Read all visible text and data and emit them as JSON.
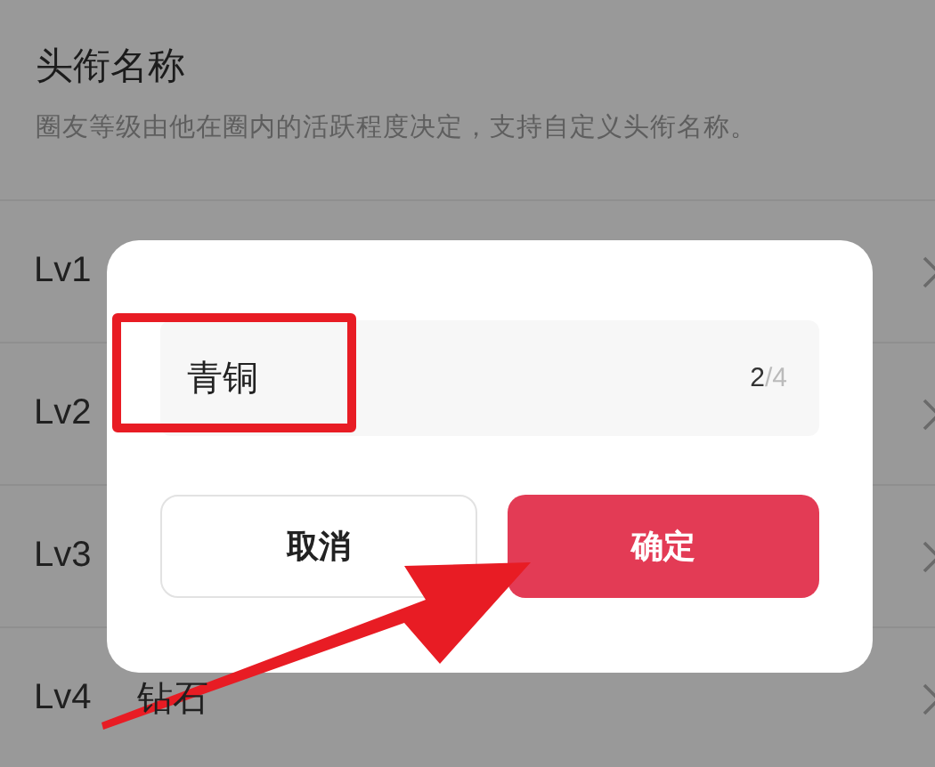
{
  "header": {
    "title": "头衔名称",
    "description": "圈友等级由他在圈内的活跃程度决定，支持自定义头衔名称。"
  },
  "levels": [
    {
      "label": "Lv1"
    },
    {
      "label": "Lv2"
    },
    {
      "label": "Lv3"
    },
    {
      "label": "Lv4",
      "value": "钻石"
    }
  ],
  "dialog": {
    "input": {
      "value": "青铜",
      "count_used": "2",
      "count_limit": "/4"
    },
    "buttons": [
      {
        "label": "取消",
        "kind": "cancel"
      },
      {
        "label": "确定",
        "kind": "confirm"
      }
    ]
  }
}
